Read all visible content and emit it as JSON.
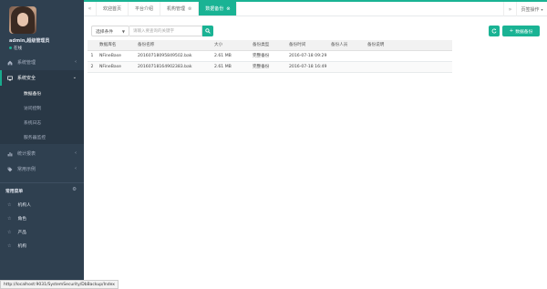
{
  "sidebar": {
    "profile": {
      "name": "admin,超级管理员",
      "status": "在线"
    },
    "nav": [
      {
        "label": "系统管理",
        "icon": "home-icon",
        "expanded": false
      },
      {
        "label": "系统安全",
        "icon": "monitor-icon",
        "expanded": true
      }
    ],
    "subnav": [
      {
        "label": "数据备份"
      },
      {
        "label": "访问控制"
      },
      {
        "label": "系统日志"
      },
      {
        "label": "服务器监控"
      }
    ],
    "nav2": [
      {
        "label": "统计报表",
        "icon": "bar-chart-icon"
      },
      {
        "label": "常用示例",
        "icon": "tag-icon"
      }
    ],
    "quick": {
      "title": "常用菜单",
      "items": [
        {
          "label": "机构人"
        },
        {
          "label": "角色"
        },
        {
          "label": "产品"
        },
        {
          "label": "机构"
        }
      ]
    }
  },
  "topbar": {
    "back": "«",
    "tabs": [
      {
        "label": "欢迎首页",
        "closable": false,
        "active": false
      },
      {
        "label": "平台介绍",
        "closable": false,
        "active": false
      },
      {
        "label": "机构管理",
        "closable": true,
        "active": false
      },
      {
        "label": "数据备份",
        "closable": true,
        "active": true
      }
    ],
    "forward": "»",
    "operations": "页签操作"
  },
  "toolbar": {
    "select_value": "选择条件",
    "search_placeholder": "请输入要查询的关键字",
    "backup_label": "数据备份"
  },
  "table": {
    "columns": [
      "",
      "数据库名",
      "备份名称",
      "大小",
      "备份类型",
      "备份时间",
      "备份人员",
      "备份说明"
    ],
    "rows": [
      [
        "1",
        "NFineBase",
        "20160718095849502.bak",
        "2.61 MB",
        "完整备份",
        "2016-07-18 09:29",
        "",
        ""
      ],
      [
        "2",
        "NFineBase",
        "20160718164902383.bak",
        "2.61 MB",
        "完整备份",
        "2016-07-18 16:49",
        "",
        ""
      ]
    ]
  },
  "statusbar": {
    "url": "http://localhost:9031/SystemSecurity/DbBackup/Index"
  },
  "colors": {
    "accent": "#1ab394",
    "sidebar_bg": "#2f4050",
    "sidebar_active": "#293846"
  }
}
